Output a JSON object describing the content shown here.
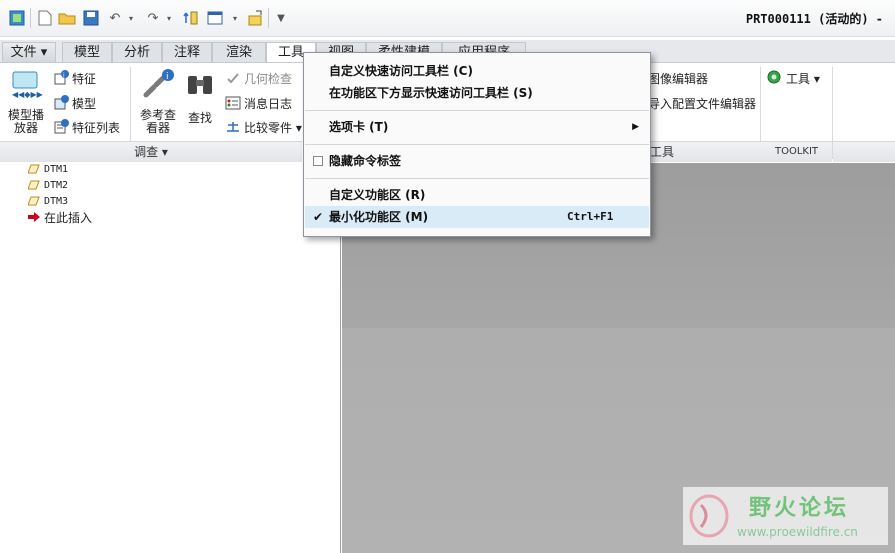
{
  "window_title": "PRT000111 (活动的) -",
  "quick_access": {
    "icons": [
      "app-icon",
      "new-icon",
      "open-icon",
      "save-icon",
      "undo-icon",
      "redo-icon",
      "regenerate-icon",
      "windows-icon",
      "close-icon",
      "customize-icon"
    ]
  },
  "tabs": [
    "文件",
    "模型",
    "分析",
    "注释",
    "渲染",
    "工具",
    "视图",
    "柔性建模",
    "应用程序"
  ],
  "tabs_active": "工具",
  "ribbon": {
    "model_player": "模型播放器",
    "feature": "特征",
    "model": "模型",
    "feature_list": "特征列表",
    "reference_viewer": "参考查看器",
    "find": "查找",
    "geometry_check": "几何检查",
    "message_log": "消息日志",
    "compare_part": "比较零件",
    "group_investigate": "调查",
    "image_editor": "图像编辑器",
    "import_config_editor": "导入配置文件编辑器",
    "group_tool_partial": "工具",
    "toolkit_tools": "工具",
    "group_toolkit": "TOOLKIT"
  },
  "tree": {
    "items": [
      "DTM1",
      "DTM2",
      "DTM3"
    ],
    "insert_here": "在此插入"
  },
  "menu": {
    "customize_qat": "自定义快速访问工具栏 (C)",
    "show_qat_below": "在功能区下方显示快速访问工具栏 (S)",
    "tabs": "选项卡 (T)",
    "hide_command_labels": "隐藏命令标签",
    "customize_ribbon": "自定义功能区 (R)",
    "minimize_ribbon": "最小化功能区 (M)",
    "minimize_shortcut": "Ctrl+F1"
  },
  "watermark": {
    "title": "野火论坛",
    "url": "www.proewildfire.cn"
  },
  "colors": {
    "accent": "#d9ebf7",
    "graphics_bg": "#a9a9a9",
    "insert_arrow": "#d0021b"
  }
}
